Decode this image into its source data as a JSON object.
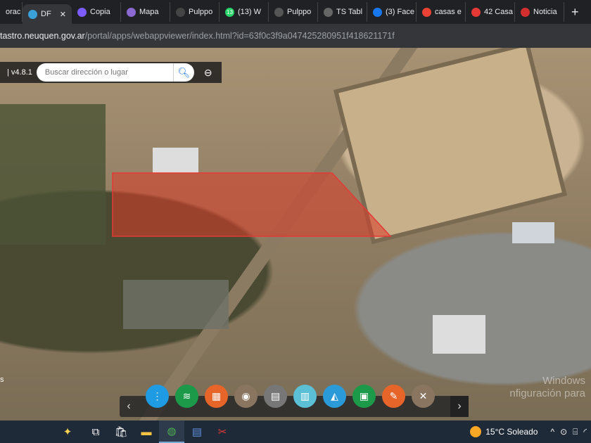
{
  "tabs": [
    {
      "label": "orac",
      "icon": "tab-favicon",
      "color": "#888"
    },
    {
      "label": "DF",
      "icon": "bing-icon",
      "color": "#3aa0d8",
      "active": true
    },
    {
      "label": "Copia",
      "icon": "heart-icon",
      "color": "#7b5cff"
    },
    {
      "label": "Mapa",
      "icon": "globe-icon",
      "color": "#8a6ad0"
    },
    {
      "label": "Pulppo",
      "icon": "pulppo-icon",
      "color": "#444"
    },
    {
      "label": "(13) W",
      "icon": "whatsapp-icon",
      "color": "#25d366",
      "badge": "13"
    },
    {
      "label": "Pulppo",
      "icon": "pulppo-icon",
      "color": "#555"
    },
    {
      "label": "TS Tabl",
      "icon": "ts-icon",
      "color": "#666"
    },
    {
      "label": "(3) Face",
      "icon": "facebook-icon",
      "color": "#1877f2"
    },
    {
      "label": "casas e",
      "icon": "google-icon",
      "color": "#ea4335"
    },
    {
      "label": "42 Casa",
      "icon": "pin-icon",
      "color": "#e53935"
    },
    {
      "label": "Noticia",
      "icon": "t-icon",
      "color": "#d32f2f"
    }
  ],
  "new_tab": "+",
  "close_tab": "✕",
  "address": {
    "host": "tastro.neuquen.gov.ar",
    "path": "/portal/apps/webappviewer/index.html?id=63f0c3f9a047425280951f418621171f"
  },
  "app": {
    "version": "| v4.8.1",
    "search_placeholder": "Buscar dirección o lugar",
    "left_edge_text": "s"
  },
  "widgets": [
    {
      "name": "more-widget",
      "color": "#1e9be3",
      "glyph": "⋮"
    },
    {
      "name": "layers-widget",
      "color": "#1c9a4a",
      "glyph": "≋"
    },
    {
      "name": "basemap-widget",
      "color": "#e8652a",
      "glyph": "▦"
    },
    {
      "name": "globe-widget",
      "color": "#8a7560",
      "glyph": "◉"
    },
    {
      "name": "document-widget",
      "color": "#777",
      "glyph": "▤"
    },
    {
      "name": "building-widget",
      "color": "#5bbfd6",
      "glyph": "▥"
    },
    {
      "name": "location-widget",
      "color": "#2a9bd8",
      "glyph": "◭"
    },
    {
      "name": "print-widget",
      "color": "#1c9a4a",
      "glyph": "▣"
    },
    {
      "name": "measure-widget",
      "color": "#e8652a",
      "glyph": "✎"
    },
    {
      "name": "tools-widget",
      "color": "#8a7560",
      "glyph": "✕"
    }
  ],
  "watermark": {
    "line1": "Windows",
    "line2": "nfiguración para"
  },
  "taskbar": {
    "weather": "15°C  Soleado",
    "tray": "^"
  }
}
